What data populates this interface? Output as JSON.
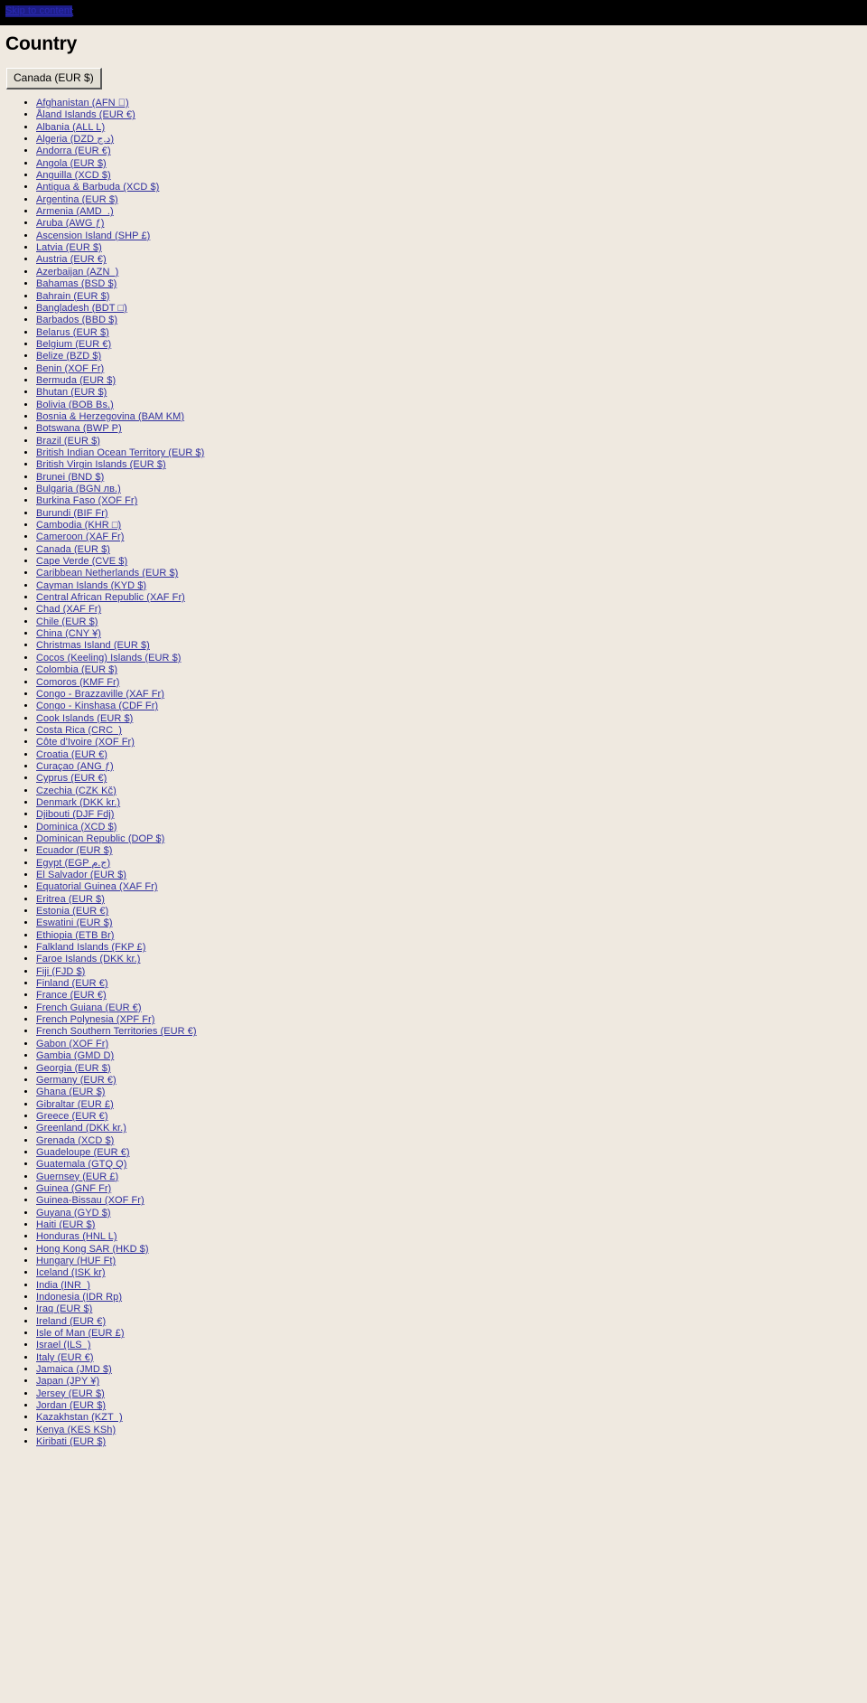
{
  "skip": {
    "label": "Skip to content"
  },
  "page": {
    "title": "Country"
  },
  "locale_selector": {
    "current_label": "Canada (EUR $)"
  },
  "colors": {
    "page_background": "#efe9e0",
    "topbar_background": "#000000",
    "link": "#2f2f9e",
    "skip_link": "#2b2bb5",
    "button_face": "#e2ded4",
    "text": "#000000"
  },
  "country_list": [
    "Afghanistan (AFN \u0000)",
    "Åland Islands (EUR €)",
    "Albania (ALL L)",
    "Algeria (DZD د.ج)",
    "Andorra (EUR €)",
    "Angola (EUR $)",
    "Anguilla (XCD $)",
    "Antigua & Barbuda (XCD $)",
    "Argentina (EUR $)",
    "Armenia (AMD  .)",
    "Aruba (AWG ƒ)",
    "Ascension Island (SHP £)",
    "Latvia (EUR $)",
    "Austria (EUR €)",
    "Azerbaijan (AZN  )",
    "Bahamas (BSD $)",
    "Bahrain (EUR $)",
    "Bangladesh (BDT □)",
    "Barbados (BBD $)",
    "Belarus (EUR $)",
    "Belgium (EUR €)",
    "Belize (BZD $)",
    "Benin (XOF Fr)",
    "Bermuda (EUR $)",
    "Bhutan (EUR $)",
    "Bolivia (BOB Bs.)",
    "Bosnia & Herzegovina (BAM KM)",
    "Botswana (BWP P)",
    "Brazil (EUR $)",
    "British Indian Ocean Territory (EUR $)",
    "British Virgin Islands (EUR $)",
    "Brunei (BND $)",
    "Bulgaria (BGN лв.)",
    "Burkina Faso (XOF Fr)",
    "Burundi (BIF Fr)",
    "Cambodia (KHR □)",
    "Cameroon (XAF Fr)",
    "Canada (EUR $)",
    "Cape Verde (CVE $)",
    "Caribbean Netherlands (EUR $)",
    "Cayman Islands (KYD $)",
    "Central African Republic (XAF Fr)",
    "Chad (XAF Fr)",
    "Chile (EUR $)",
    "China (CNY ¥)",
    "Christmas Island (EUR $)",
    "Cocos (Keeling) Islands (EUR $)",
    "Colombia (EUR $)",
    "Comoros (KMF Fr)",
    "Congo - Brazzaville (XAF Fr)",
    "Congo - Kinshasa (CDF Fr)",
    "Cook Islands (EUR $)",
    "Costa Rica (CRC  )",
    "Côte d'Ivoire (XOF Fr)",
    "Croatia (EUR €)",
    "Curaçao (ANG ƒ)",
    "Cyprus (EUR €)",
    "Czechia (CZK Kč)",
    "Denmark (DKK kr.)",
    "Djibouti (DJF Fdj)",
    "Dominica (XCD $)",
    "Dominican Republic (DOP $)",
    "Ecuador (EUR $)",
    "Egypt (EGP ج.م)",
    "El Salvador (EUR $)",
    "Equatorial Guinea (XAF Fr)",
    "Eritrea (EUR $)",
    "Estonia (EUR €)",
    "Eswatini (EUR $)",
    "Ethiopia (ETB Br)",
    "Falkland Islands (FKP £)",
    "Faroe Islands (DKK kr.)",
    "Fiji (FJD $)",
    "Finland (EUR €)",
    "France (EUR €)",
    "French Guiana (EUR €)",
    "French Polynesia (XPF Fr)",
    "French Southern Territories (EUR €)",
    "Gabon (XOF Fr)",
    "Gambia (GMD D)",
    "Georgia (EUR $)",
    "Germany (EUR €)",
    "Ghana (EUR $)",
    "Gibraltar (EUR £)",
    "Greece (EUR €)",
    "Greenland (DKK kr.)",
    "Grenada (XCD $)",
    "Guadeloupe (EUR €)",
    "Guatemala (GTQ Q)",
    "Guernsey (EUR £)",
    "Guinea (GNF Fr)",
    "Guinea-Bissau (XOF Fr)",
    "Guyana (GYD $)",
    "Haiti (EUR $)",
    "Honduras (HNL L)",
    "Hong Kong SAR (HKD $)",
    "Hungary (HUF Ft)",
    "Iceland (ISK kr)",
    "India (INR  )",
    "Indonesia (IDR Rp)",
    "Iraq (EUR $)",
    "Ireland (EUR €)",
    "Isle of Man (EUR £)",
    "Israel (ILS  )",
    "Italy (EUR €)",
    "Jamaica (JMD $)",
    "Japan (JPY ¥)",
    "Jersey (EUR $)",
    "Jordan (EUR $)",
    "Kazakhstan (KZT  )",
    "Kenya (KES KSh)",
    "Kiribati (EUR $)"
  ]
}
